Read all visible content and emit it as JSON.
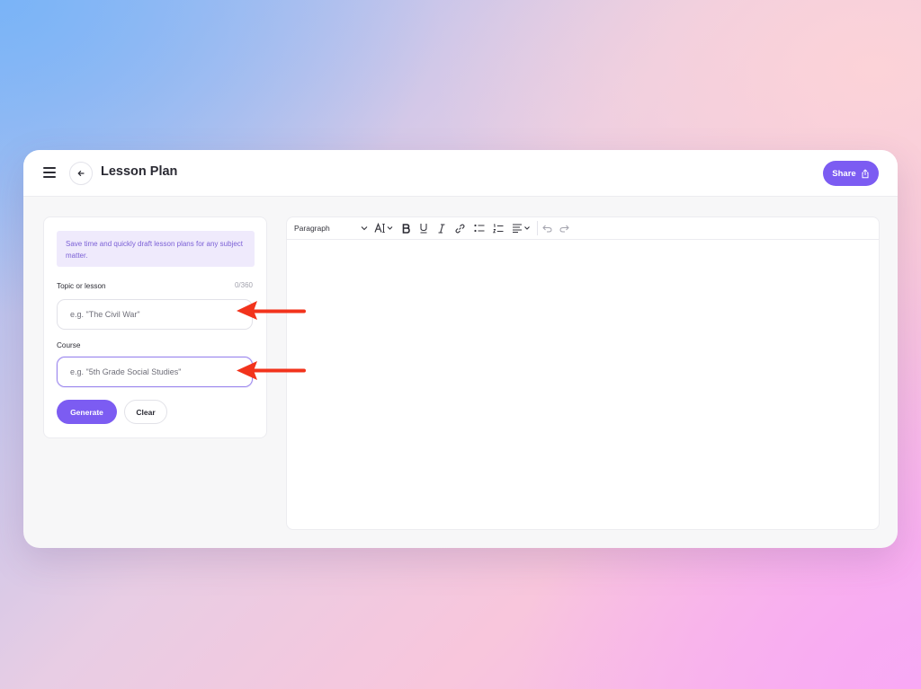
{
  "app": {
    "title": "Lesson Plan",
    "share_label": "Share",
    "accent_color": "#7c5cf2"
  },
  "icons": {
    "menu": "hamburger-menu-icon",
    "back": "arrow-left-icon",
    "share": "share-upload-icon"
  },
  "form": {
    "info_text": "Save time and quickly draft lesson plans for any subject matter.",
    "topic_label": "Topic or lesson",
    "topic_count": "0/360",
    "topic_placeholder": "e.g. \"The Civil War\"",
    "topic_value": "",
    "course_label": "Course",
    "course_placeholder": "e.g. \"5th Grade Social Studies\"",
    "course_value": "",
    "generate_label": "Generate",
    "clear_label": "Clear"
  },
  "toolbar": {
    "block_type": "Paragraph",
    "tools": [
      "font-size-icon",
      "bold-icon",
      "underline-icon",
      "italic-icon",
      "link-icon",
      "bullet-list-icon",
      "numbered-list-icon",
      "align-icon",
      "undo-icon",
      "redo-icon"
    ]
  },
  "annotations": {
    "arrow_color": "#f2331c"
  }
}
